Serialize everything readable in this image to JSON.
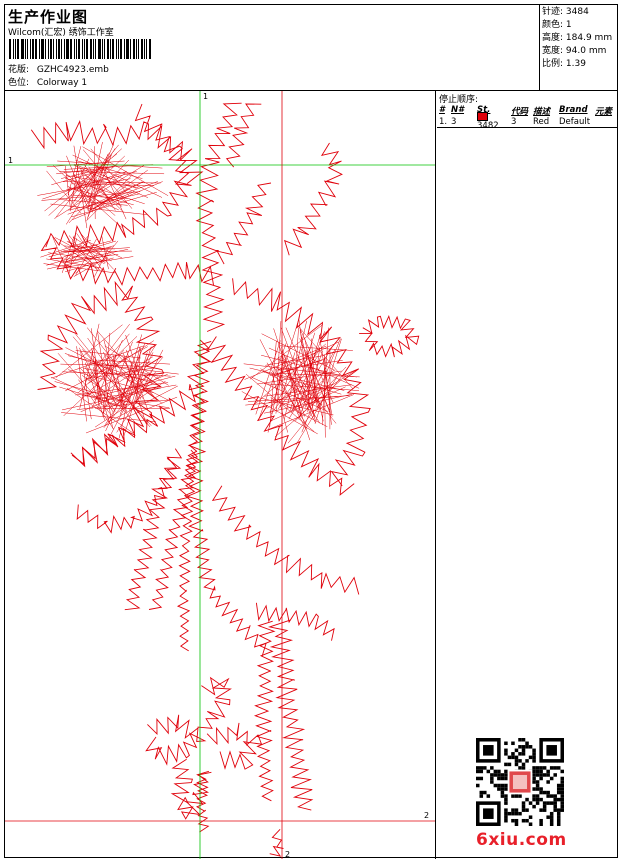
{
  "header": {
    "title": "生产作业图",
    "company": "Wilcom(汇宏) 绣饰工作室",
    "design_label": "花版:",
    "design_file": "GZHC4923.emb",
    "colorway_label": "色位:",
    "colorway": "Colorway 1"
  },
  "stats": [
    {
      "label": "针迹:",
      "value": "3484"
    },
    {
      "label": "颜色:",
      "value": "1"
    },
    {
      "label": "高度:",
      "value": "184.9 mm"
    },
    {
      "label": "宽度:",
      "value": "94.0 mm"
    },
    {
      "label": "比例:",
      "value": "1.39"
    }
  ],
  "panel": {
    "title": "停止顺序:",
    "columns": {
      "idx": "#",
      "no": "N#",
      "st": "St.",
      "code": "代码",
      "desc": "描述",
      "brand": "Brand",
      "elem": "元素"
    },
    "rows": [
      {
        "idx": "1.",
        "no": "3",
        "st": "3482",
        "code": "3",
        "desc": "Red",
        "brand": "Default",
        "elem": ""
      }
    ]
  },
  "guides": {
    "h1": "1",
    "v1": "1",
    "h2": "2",
    "v2": "2"
  },
  "colors": {
    "stitch": "#e0000a",
    "guide_green": "#00c000",
    "guide_red": "#e0000a"
  },
  "watermark": "6xiu.com"
}
